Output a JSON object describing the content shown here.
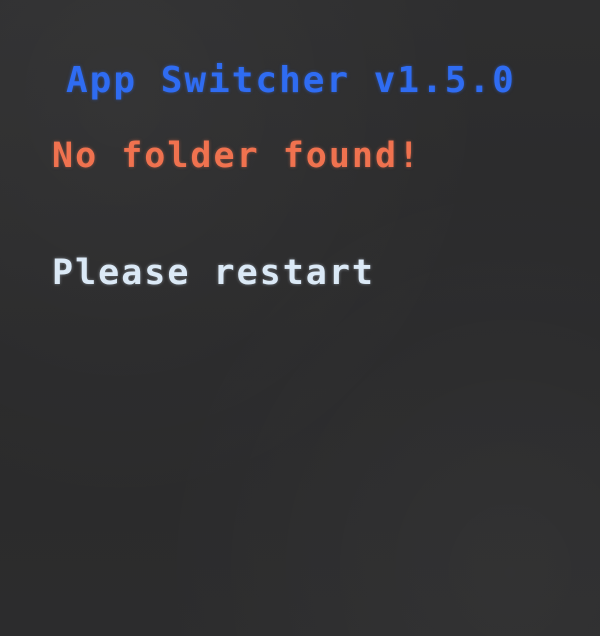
{
  "screen": {
    "title": "App Switcher v1.5.0",
    "error_message": "No folder found!",
    "instruction": "Please restart"
  },
  "colors": {
    "title": "#2f6cf2",
    "error": "#f0724f",
    "instruction": "#dbe9f6",
    "background": "#2b2b2c"
  }
}
